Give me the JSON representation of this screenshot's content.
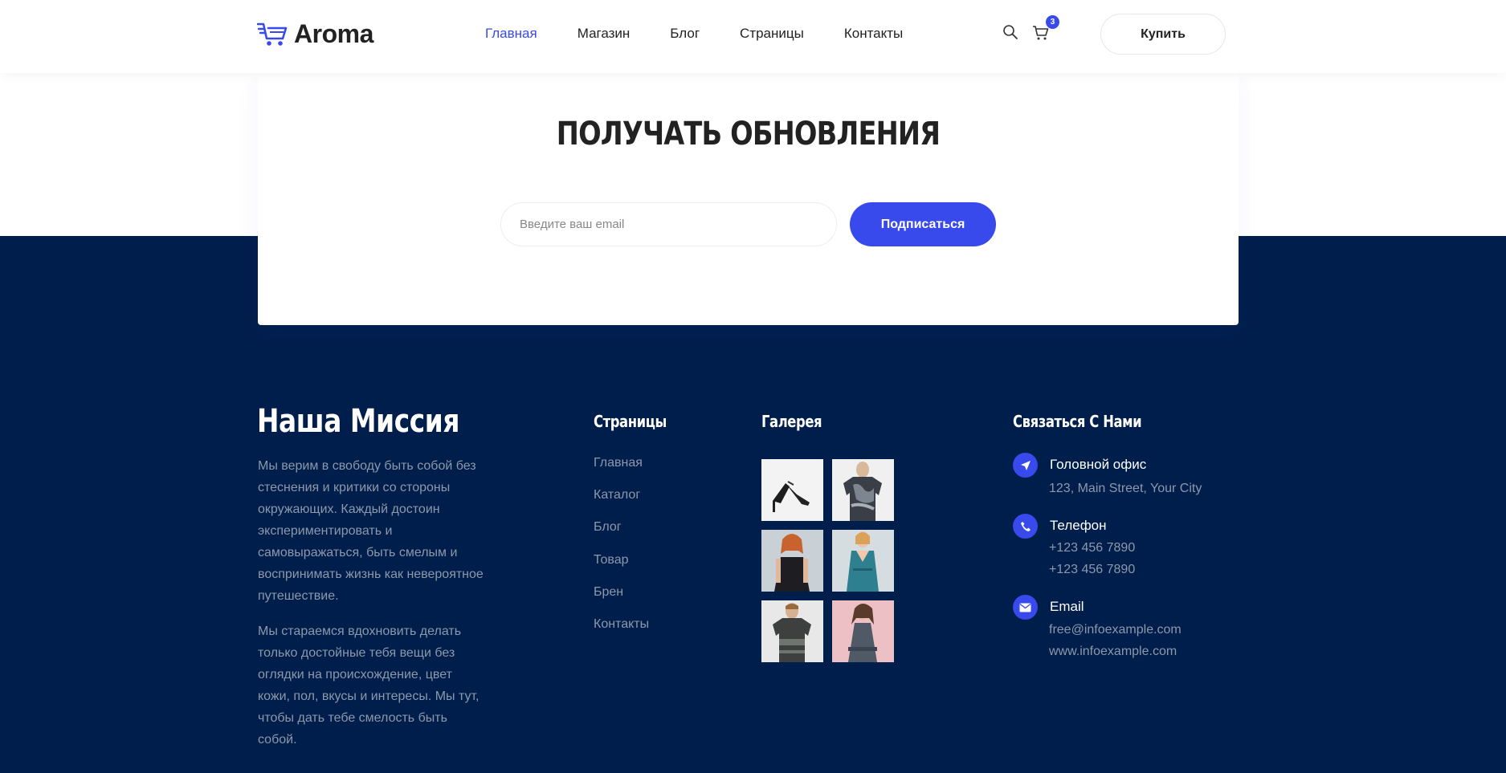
{
  "header": {
    "brand": "Aroma",
    "nav": [
      {
        "label": "Главная",
        "active": true
      },
      {
        "label": "Магазин",
        "active": false
      },
      {
        "label": "Блог",
        "active": false
      },
      {
        "label": "Страницы",
        "active": false
      },
      {
        "label": "Контакты",
        "active": false
      }
    ],
    "cart_count": "3",
    "buy_label": "Купить"
  },
  "subscribe": {
    "title": "ПОЛУЧАТЬ ОБНОВЛЕНИЯ",
    "email_placeholder": "Введите ваш email",
    "email_value": "",
    "button_label": "Подписаться"
  },
  "footer": {
    "mission": {
      "title": "Наша Миссия",
      "paragraphs": [
        "Мы верим в свободу быть собой без стеснения и критики со стороны окружающих. Каждый достоин экспериментировать и самовыражаться, быть смелым и воспринимать жизнь как невероятное путешествие.",
        "Мы стараемся вдохновить делать только достойные тебя вещи без оглядки на происхождение, цвет кожи, пол, вкусы и интересы. Мы тут, чтобы дать тебе смелость быть собой."
      ]
    },
    "pages": {
      "title": "Страницы",
      "links": [
        "Главная",
        "Каталог",
        "Блог",
        "Товар",
        "Брен",
        "Контакты"
      ]
    },
    "gallery": {
      "title": "Галерея",
      "items": [
        "high-heel-sandal-image",
        "camo-tshirt-model-image",
        "black-dress-model-image",
        "teal-dress-model-image",
        "grey-tshirt-model-image",
        "grey-top-model-image"
      ]
    },
    "contact": {
      "title": "Связаться С Нами",
      "office": {
        "label": "Головной офис",
        "address": "123, Main Street, Your City"
      },
      "phone": {
        "label": "Телефон",
        "numbers": [
          "+123 456 7890",
          "+123 456 7890"
        ]
      },
      "email": {
        "label": "Email",
        "lines": [
          "free@infoexample.com",
          "www.infoexample.com"
        ]
      }
    }
  },
  "colors": {
    "accent": "#384aeb",
    "footer_bg": "#001e4b",
    "muted_text": "#8d98aa",
    "heading_dark": "#222222"
  }
}
